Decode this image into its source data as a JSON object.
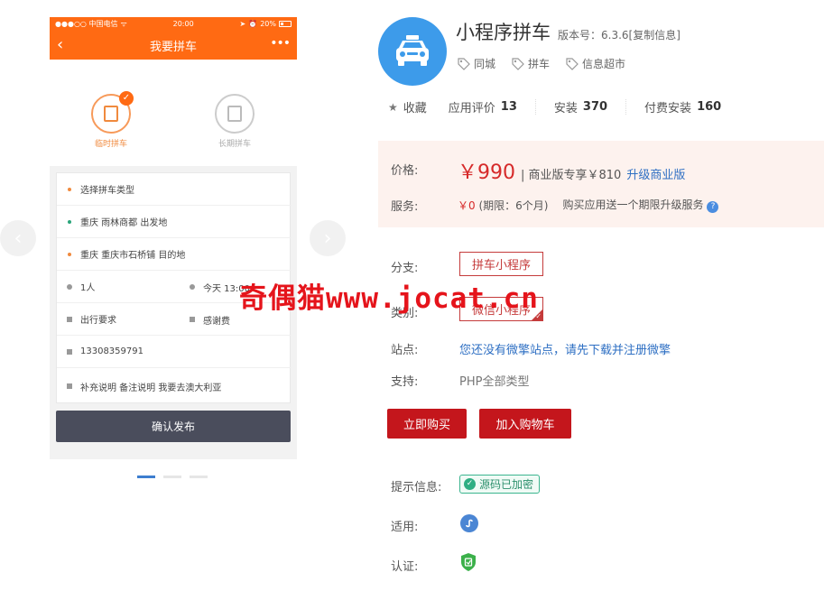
{
  "phone": {
    "status": {
      "carrier": "●●●○○ 中国电信",
      "wifi": "ᯤ",
      "time": "20:00",
      "battery_text": "20%"
    },
    "nav_title": "我要拼车",
    "modes": [
      {
        "label": "临时拼车",
        "active": true
      },
      {
        "label": "长期拼车",
        "active": false
      }
    ],
    "form": {
      "type": "选择拼车类型",
      "departure": "重庆  雨林商都  出发地",
      "destination": "重庆  重庆市石桥铺  目的地",
      "people": "1人",
      "time": "今天 13:00",
      "requirements": "出行要求",
      "thanks_fee": "感谢费",
      "phone": "13308359791",
      "notes": "补充说明  备注说明  我要去澳大利亚"
    },
    "confirm_label": "确认发布"
  },
  "app": {
    "name": "小程序拼车",
    "version": "版本号：6.3.6[复制信息]",
    "tags": [
      "同城",
      "拼车",
      "信息超市"
    ]
  },
  "stats": {
    "favorite": "收藏",
    "rating_label": "应用评价",
    "rating_value": "13",
    "install_label": "安装",
    "install_value": "370",
    "paid_label": "付费安装",
    "paid_value": "160"
  },
  "price": {
    "label": "价格:",
    "amount": "￥990",
    "biz": "| 商业版专享￥810",
    "upgrade": "升级商业版",
    "service_label": "服务:",
    "service_value": "￥0",
    "service_period": "(期限：6个月)",
    "service_note": "购买应用送一个期限升级服务",
    "help_icon": "?"
  },
  "details": {
    "branch_label": "分支:",
    "branch_value": "拼车小程序",
    "category_label": "类别:",
    "category_value": "微信小程序",
    "site_label": "站点:",
    "site_value": "您还没有微擎站点，请先下载并注册微擎",
    "support_label": "支持:",
    "support_value": "PHP全部类型"
  },
  "actions": {
    "buy": "立即购买",
    "cart": "加入购物车"
  },
  "info": {
    "hint_label": "提示信息:",
    "hint_badge": "源码已加密",
    "apply_label": "适用:",
    "cert_label": "认证:"
  },
  "watermark": "奇偶猫www.jocat.cn",
  "colors": {
    "phone_orange": "#ff6a13",
    "price_red": "#d62a2a",
    "button_red": "#c4161c",
    "link_blue": "#2e6fc3",
    "icon_blue": "#3d9bea"
  }
}
